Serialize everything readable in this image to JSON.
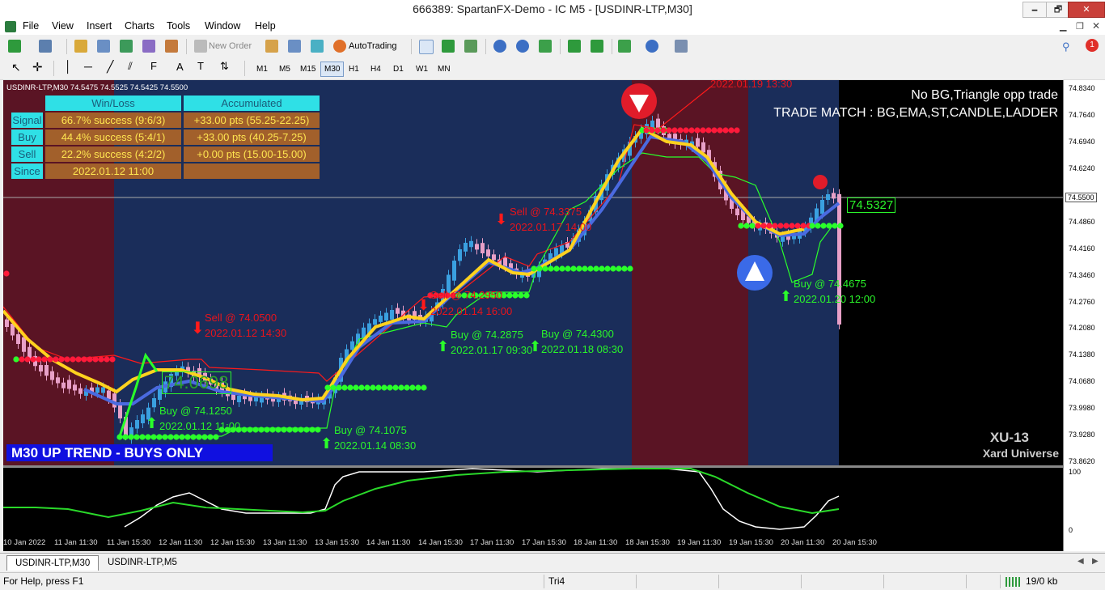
{
  "window": {
    "title": "666389: SpartanFX-Demo - IC M5 - [USDINR-LTP,M30]",
    "minimize": "🗕",
    "restore": "🗗",
    "close": "✕"
  },
  "menu": [
    "File",
    "View",
    "Insert",
    "Charts",
    "Tools",
    "Window",
    "Help"
  ],
  "toolbar": {
    "new_order": "New Order",
    "autotrading": "AutoTrading",
    "timeframes": [
      "M1",
      "M5",
      "M15",
      "M30",
      "H1",
      "H4",
      "D1",
      "W1",
      "MN"
    ],
    "active_timeframe": "M30",
    "notification_count": "1"
  },
  "chart": {
    "symbol_info": "USDINR-LTP,M30  74.5475 74.5525 74.5425 74.5500",
    "current_price_label": "74.5327",
    "bid_line_price": "74.5500",
    "mid_price_label": "74.0698",
    "price_ticks": [
      "74.8340",
      "74.7640",
      "74.6940",
      "74.6240",
      "74.5500",
      "74.4860",
      "74.4160",
      "74.3460",
      "74.2760",
      "74.2080",
      "74.1380",
      "74.0680",
      "73.9980",
      "73.9280",
      "73.8620"
    ],
    "sub_ticks": [
      "100",
      "0"
    ],
    "time_labels": [
      "10 Jan 2022",
      "11 Jan 11:30",
      "11 Jan 15:30",
      "12 Jan 11:30",
      "12 Jan 15:30",
      "13 Jan 11:30",
      "13 Jan 15:30",
      "14 Jan 11:30",
      "14 Jan 15:30",
      "17 Jan 11:30",
      "17 Jan 15:30",
      "18 Jan 11:30",
      "18 Jan 15:30",
      "19 Jan 11:30",
      "19 Jan 15:30",
      "20 Jan 11:30",
      "20 Jan 15:30"
    ],
    "stats": {
      "header_winloss": "Win/Loss",
      "header_accum": "Accumulated",
      "rows": [
        {
          "label": "Signal",
          "winloss": "66.7% success (9:6/3)",
          "accum": "+33.00 pts (55.25-22.25)"
        },
        {
          "label": "Buy",
          "winloss": "44.4% success (5:4/1)",
          "accum": "+33.00 pts (40.25-7.25)"
        },
        {
          "label": "Sell",
          "winloss": "22.2% success (4:2/2)",
          "accum": "+0.00 pts (15.00-15.00)"
        },
        {
          "label": "Since",
          "winloss": "2022.01.12 11:00",
          "accum": ""
        }
      ]
    },
    "top_right_1": "No BG,Triangle  opp trade",
    "top_right_2": "TRADE MATCH : BG,EMA,ST,CANDLE,LADDER",
    "top_timestamp": "2022.01.19 13:30",
    "trend_label": "M30 UP TREND - BUYS ONLY",
    "brand_1": "XU-13",
    "brand_2": "Xard Universe",
    "annotations": [
      {
        "text": "Sell @ 74.0500",
        "color": "red"
      },
      {
        "text": "2022.01.12 14:30",
        "color": "red"
      },
      {
        "text": "Buy @ 74.1250",
        "color": "green"
      },
      {
        "text": "2022.01.12 11:00",
        "color": "green"
      },
      {
        "text": "Buy @ 74.1075",
        "color": "green"
      },
      {
        "text": "2022.01.14 08:30",
        "color": "green"
      },
      {
        "text": "Sell @ 74.2950",
        "color": "red"
      },
      {
        "text": "2022.01.14 16:00",
        "color": "red"
      },
      {
        "text": "Buy @ 74.2875",
        "color": "green"
      },
      {
        "text": "2022.01.17 09:30",
        "color": "green"
      },
      {
        "text": "Buy @ 74.4300",
        "color": "green"
      },
      {
        "text": "2022.01.18 08:30",
        "color": "green"
      },
      {
        "text": "Sell @ 74.3375",
        "color": "red"
      },
      {
        "text": "2022.01.17 14:00",
        "color": "red"
      },
      {
        "text": "Buy @ 74.4675",
        "color": "green"
      },
      {
        "text": "2022.01.20 12:00",
        "color": "green"
      }
    ],
    "colors": {
      "bg_blue": "#1a2d5a",
      "bg_red": "#5a1424",
      "ema": "#ffd21e",
      "ema2": "#4a6ae0",
      "st_green": "#2aff2a",
      "st_red": "#ff1a3a",
      "candle_up": "#3aa0e0",
      "candle_down": "#e8a0c8"
    }
  },
  "tabs": [
    "USDINR-LTP,M30",
    "USDINR-LTP,M5"
  ],
  "status": {
    "help": "For Help, press F1",
    "profile": "Tri4",
    "traffic": "19/0 kb"
  }
}
